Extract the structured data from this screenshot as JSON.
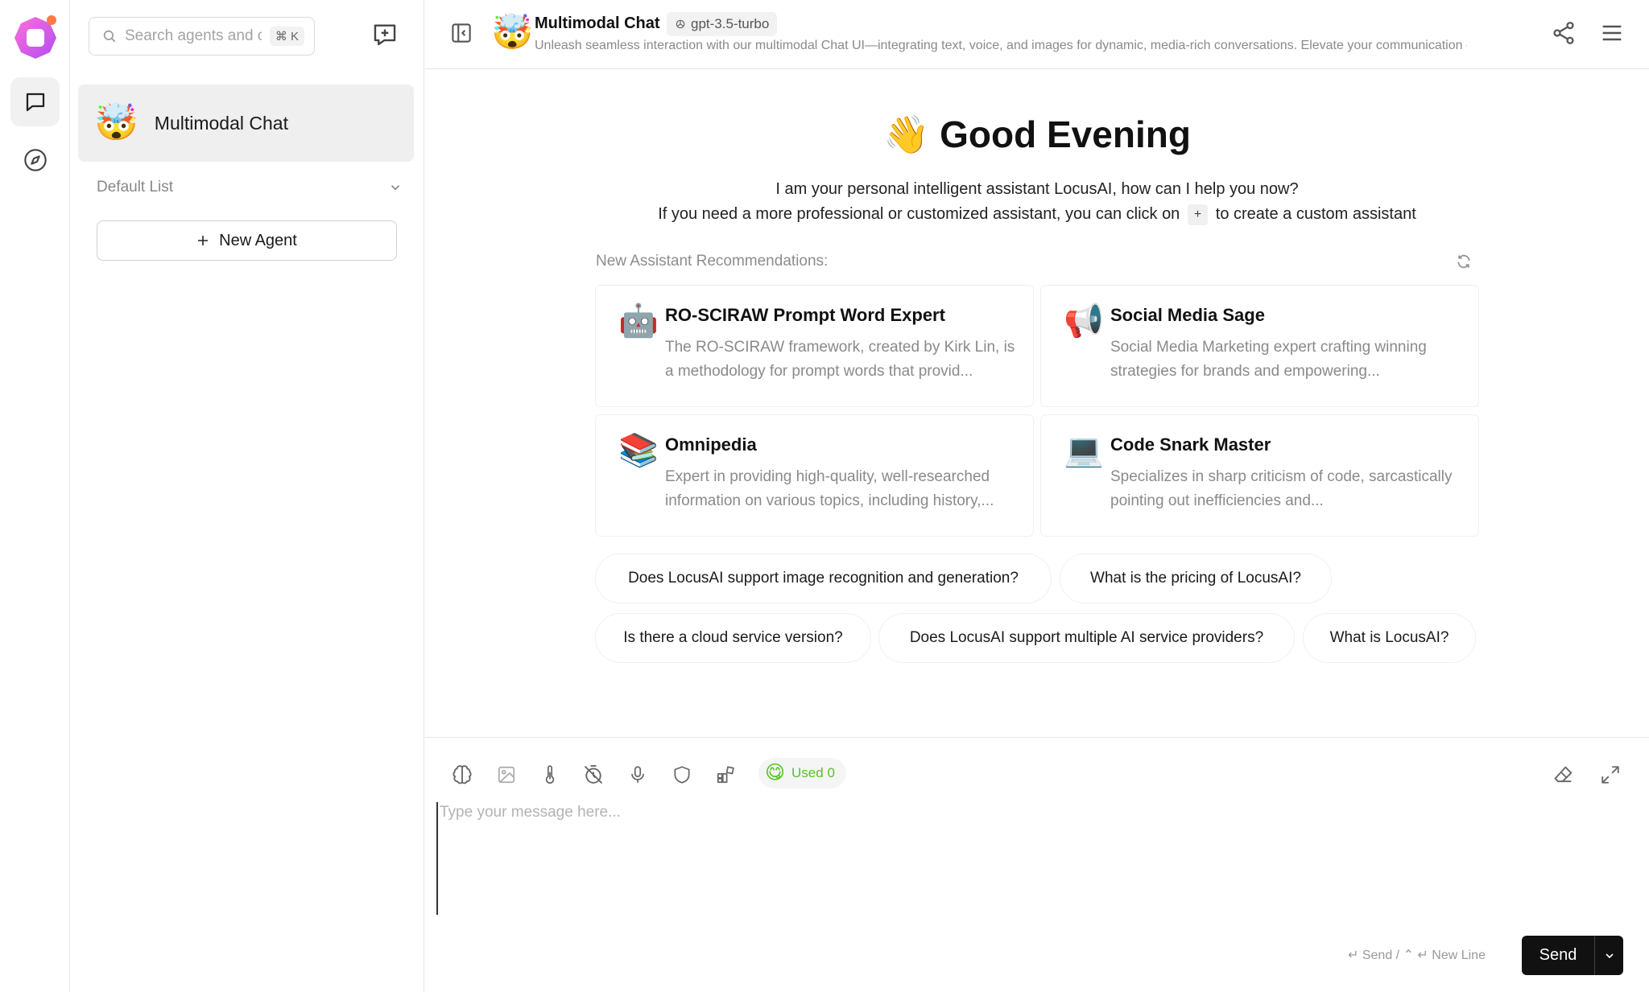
{
  "sidebar": {
    "search_placeholder": "Search agents and c",
    "search_shortcut": "⌘ K",
    "agent_name": "Multimodal Chat",
    "agent_avatar": "🤯",
    "group_label": "Default List",
    "new_agent_label": "New Agent"
  },
  "header": {
    "avatar": "🤯",
    "title": "Multimodal Chat",
    "model": "gpt-3.5-turbo",
    "description": "Unleash seamless interaction with our multimodal Chat UI—integrating text, voice, and images for dynamic, media-rich conversations. Elevate your communication e"
  },
  "welcome": {
    "emoji": "👋",
    "greeting": "Good Evening",
    "line1": "I am your personal intelligent assistant LocusAI, how can I help you now?",
    "line2_before": "If you need a more professional or customized assistant, you can click on",
    "line2_key": "+",
    "line2_after": "to create a custom assistant"
  },
  "recommendations": {
    "label": "New Assistant Recommendations:",
    "cards": [
      {
        "emoji": "🤖",
        "title": "RO-SCIRAW Prompt Word Expert",
        "desc": "The RO-SCIRAW framework, created by Kirk Lin, is a methodology for prompt words that provid..."
      },
      {
        "emoji": "📢",
        "title": "Social Media Sage",
        "desc": "Social Media Marketing expert crafting winning strategies for brands and empowering..."
      },
      {
        "emoji": "📚",
        "title": "Omnipedia",
        "desc": "Expert in providing high-quality, well-researched information on various topics, including history,..."
      },
      {
        "emoji": "💻",
        "title": "Code Snark Master",
        "desc": "Specializes in sharp criticism of code, sarcastically pointing out inefficiencies and..."
      }
    ]
  },
  "questions": [
    "Does LocusAI support image recognition and generation?",
    "What is the pricing of LocusAI?",
    "Is there a cloud service version?",
    "Does LocusAI support multiple AI service providers?",
    "What is LocusAI?"
  ],
  "input": {
    "used_emoji": "😋",
    "used_label": "Used 0",
    "placeholder": "Type your message here...",
    "hint": "↵ Send / ⌃ ↵ New Line",
    "send_label": "Send"
  },
  "icons": {
    "rail": [
      "app-logo",
      "chat-icon",
      "discover-compass-icon"
    ],
    "toolbar": [
      "brain-model-icon",
      "image-upload-icon",
      "temperature-icon",
      "history-off-icon",
      "microphone-icon",
      "shield-icon",
      "plugins-icon",
      "eraser-icon",
      "expand-icon"
    ]
  },
  "colors": {
    "accent_logo": "#e056c9",
    "used_green": "#52c41a",
    "send_bg": "#111111"
  }
}
